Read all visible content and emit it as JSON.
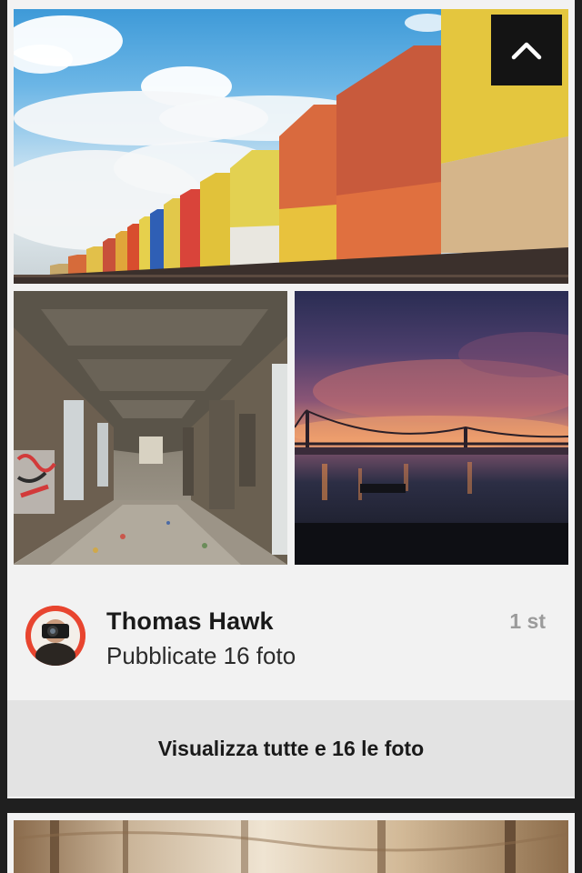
{
  "feed": {
    "post": {
      "photos": [
        {
          "subject": "container-train"
        },
        {
          "subject": "abandoned-corridor"
        },
        {
          "subject": "bridge-sunset"
        }
      ],
      "scroll_top_icon": "chevron-up-icon",
      "author": {
        "name": "Thomas Hawk",
        "subtitle": "Pubblicate 16 foto",
        "timestamp": "1 st"
      },
      "view_all_label": "Visualizza tutte e 16 le foto"
    },
    "next_post": {
      "photos": [
        {
          "subject": "forest-trees"
        }
      ]
    }
  },
  "colors": {
    "card_background": "#f2f2f2",
    "button_background": "#e3e3e3",
    "feed_background": "#1f1f1f",
    "timestamp": "#9b9b9b",
    "avatar_accent": "#e8452f"
  }
}
